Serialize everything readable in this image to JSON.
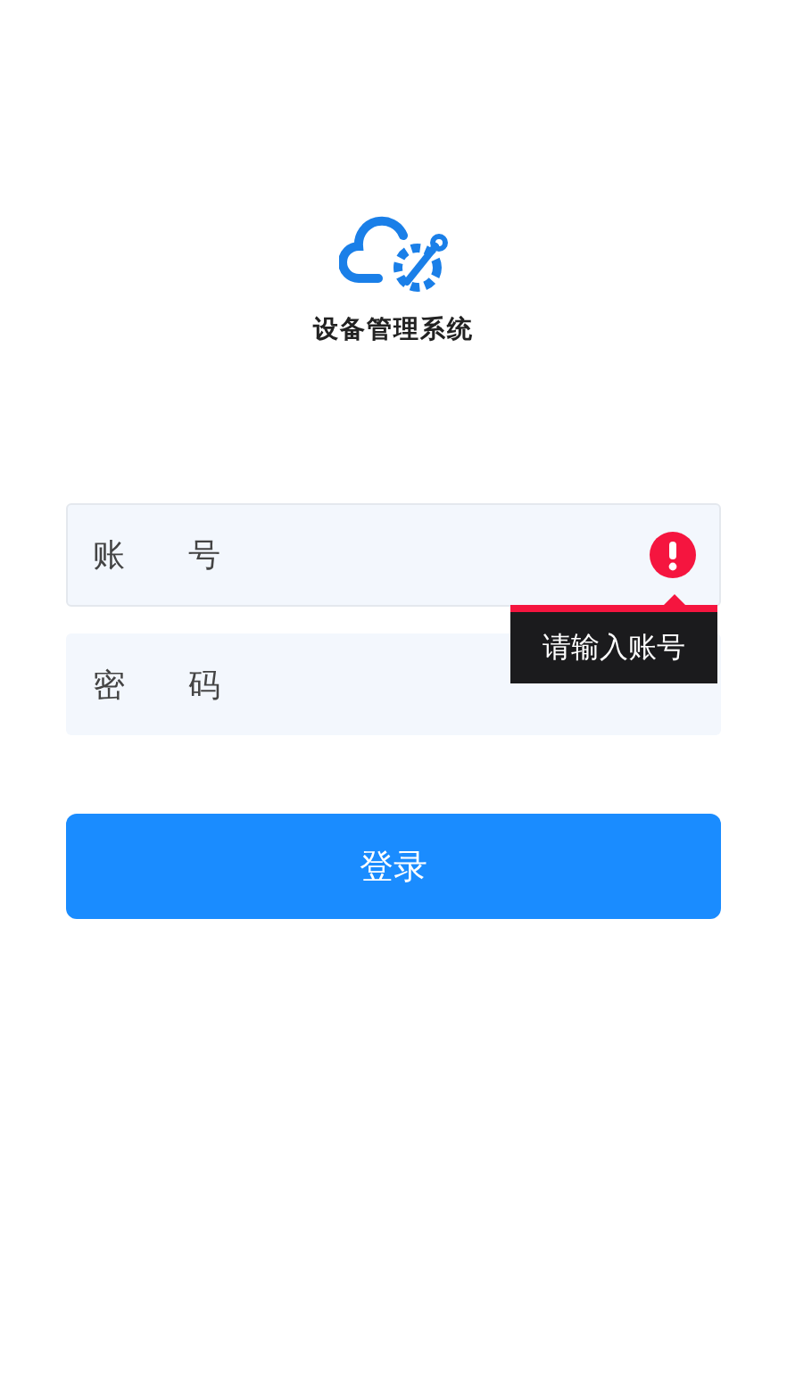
{
  "app": {
    "title": "设备管理系统"
  },
  "fields": [
    {
      "label": "账 号",
      "error": true,
      "error_message": "请输入账号"
    },
    {
      "label": "密 码",
      "error": false
    }
  ],
  "submit": {
    "label": "登录"
  }
}
